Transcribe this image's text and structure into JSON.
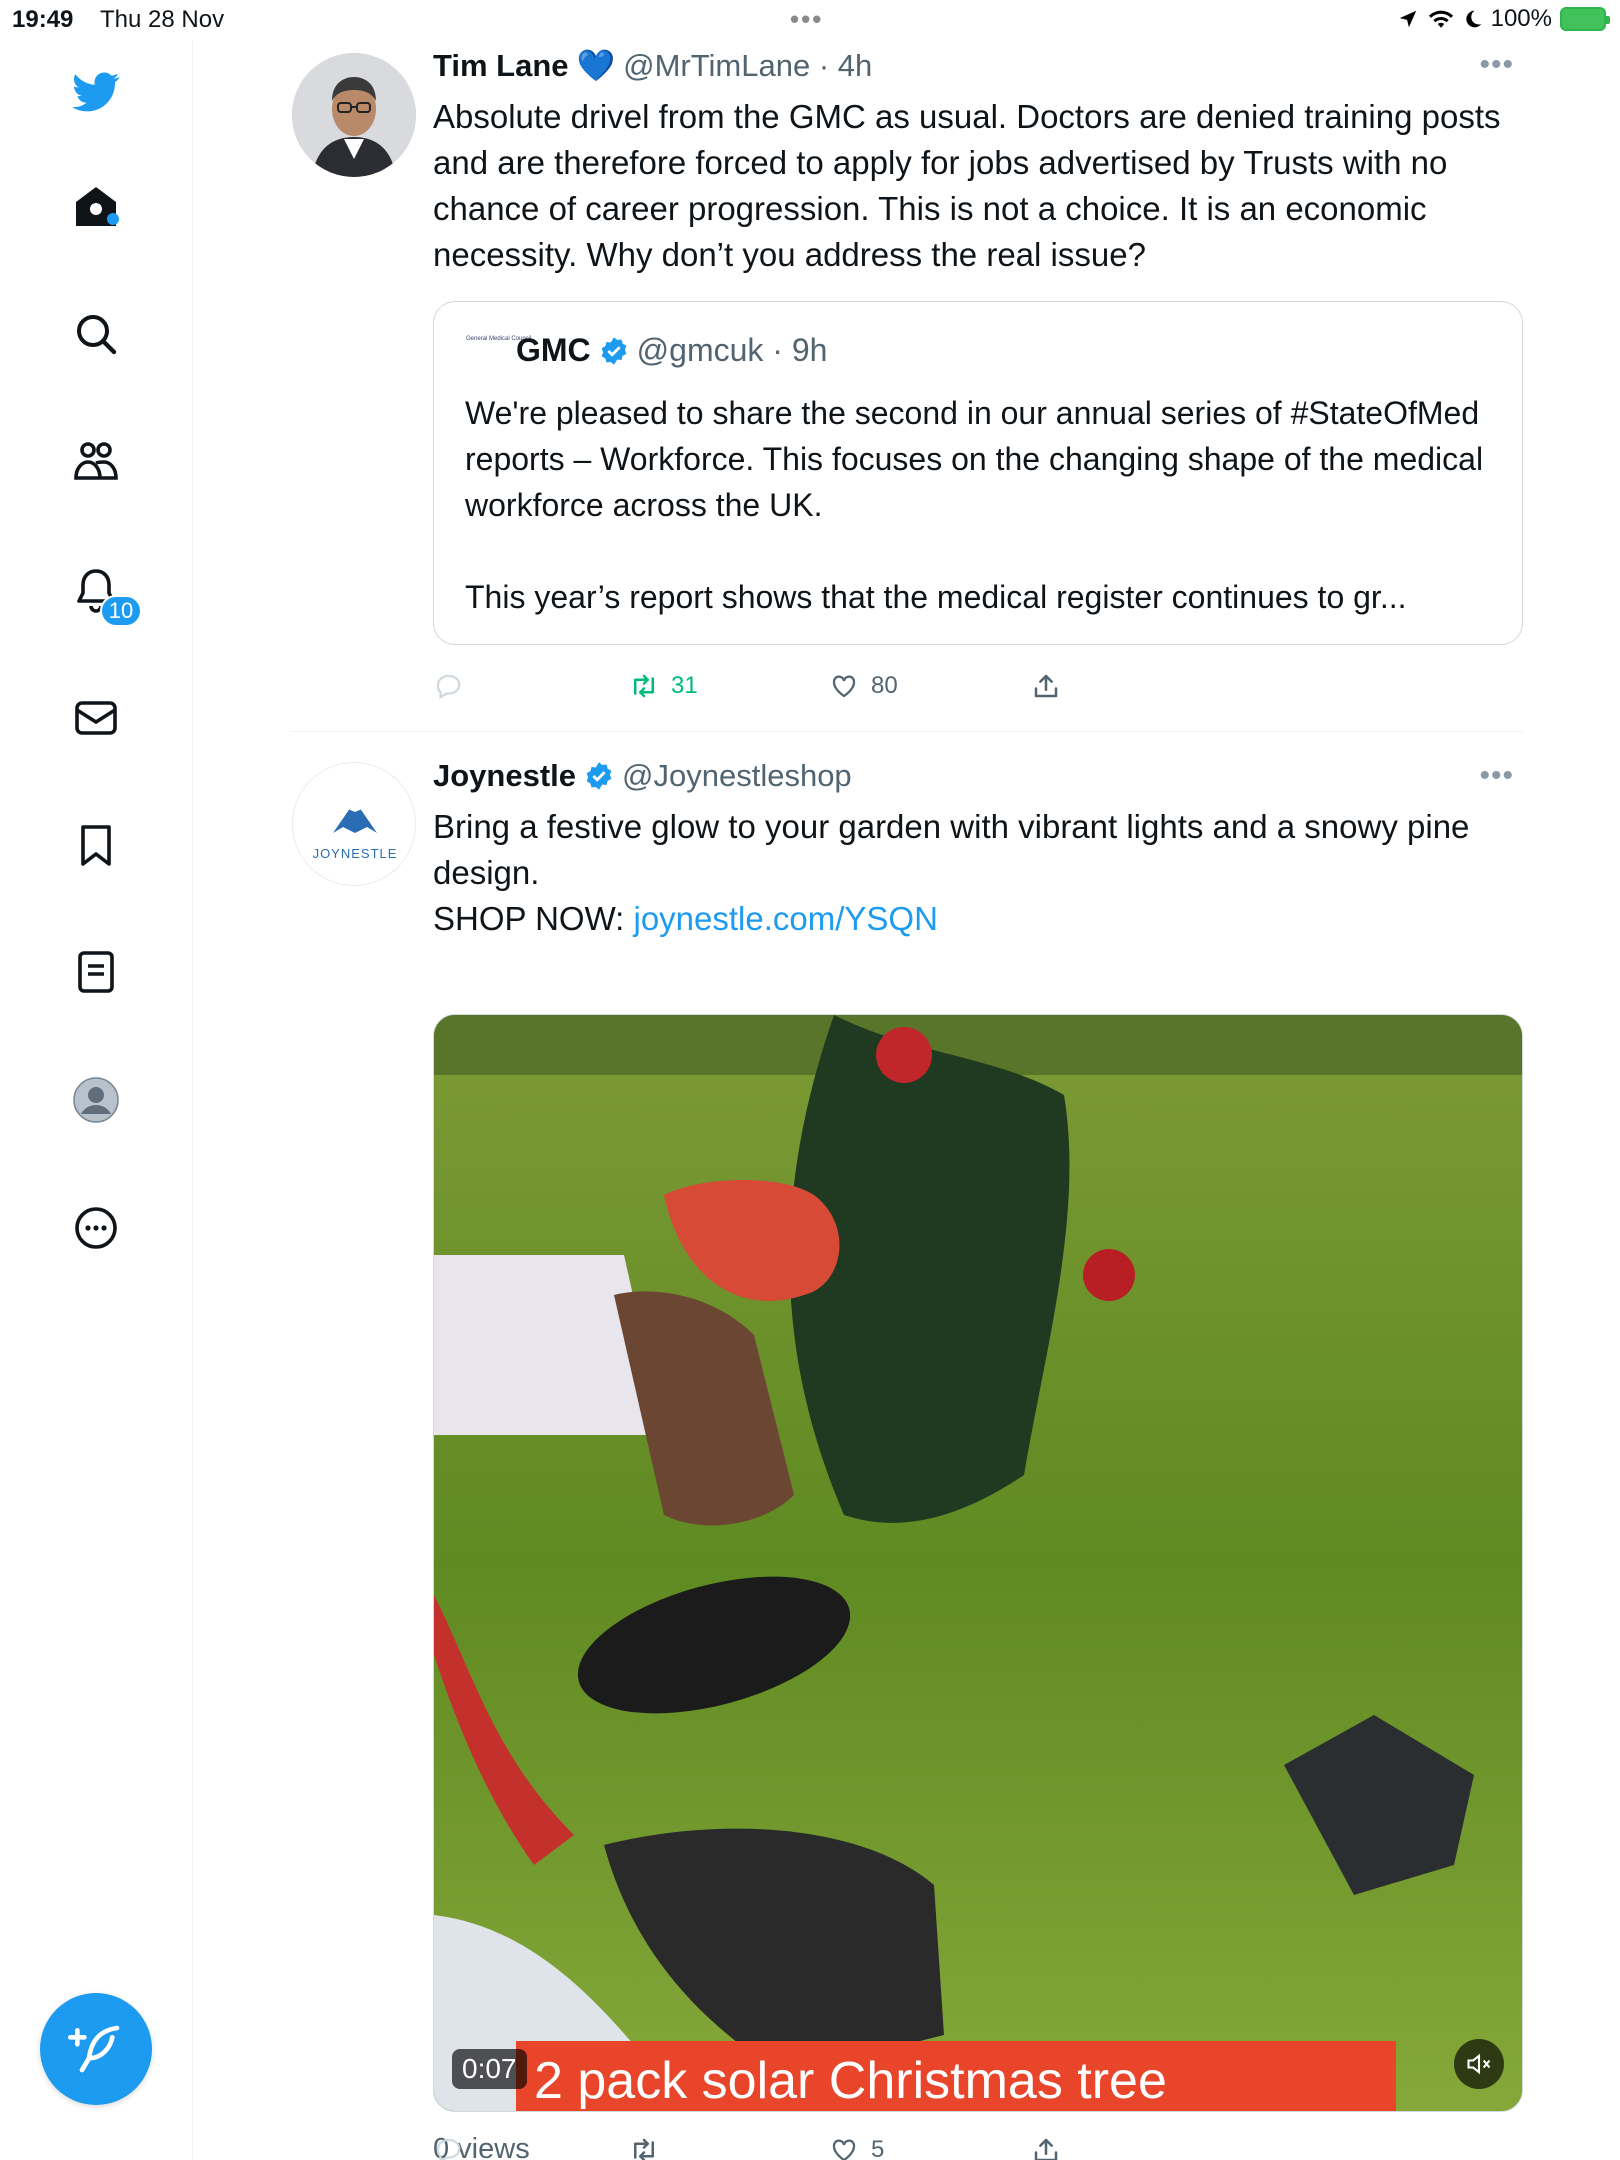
{
  "status_bar": {
    "time": "19:49",
    "date": "Thu 28 Nov",
    "battery": "100%"
  },
  "sidebar": {
    "items": [
      {
        "name": "home"
      },
      {
        "name": "explore"
      },
      {
        "name": "communities"
      },
      {
        "name": "notifications",
        "badge": "10"
      },
      {
        "name": "messages"
      },
      {
        "name": "bookmarks"
      },
      {
        "name": "lists"
      },
      {
        "name": "profile"
      },
      {
        "name": "more"
      }
    ]
  },
  "tweets": [
    {
      "name": "Tim Lane",
      "emoji": "💙",
      "handle": "@MrTimLane",
      "time": "4h",
      "text": "Absolute drivel from the GMC as usual. Doctors are denied training posts and are therefore forced to apply for jobs advertised by Trusts with no chance of career progression. This is not a choice. It is an economic necessity. Why don’t you address the real issue?",
      "quote": {
        "logo_text": "General Medical Council",
        "name": "GMC",
        "handle": "@gmcuk",
        "time": "9h",
        "text": "We're pleased to share the second in our annual series of #StateOfMed reports – Workforce. This focuses on the changing shape of the medical workforce across the UK.\n\nThis year’s report shows that the medical register continues to gr..."
      },
      "stats": {
        "replies": "",
        "retweets": "31",
        "likes": "80"
      }
    },
    {
      "name": "Joynestle",
      "handle": "@Joynestleshop",
      "avatar_text": "JOYNESTLE",
      "text_line": "Bring a festive glow to your garden with vibrant lights and a snowy pine design.",
      "shop_label": "SHOP NOW: ",
      "link": "joynestle.com/YSQN",
      "video": {
        "duration": "0:07",
        "caption": "2 pack solar Christmas tree"
      },
      "views": "0 views",
      "stats": {
        "replies": "",
        "retweets": "",
        "likes": "5"
      }
    }
  ],
  "colors": {
    "accent": "#1d9bf0",
    "retweet_active": "#00ba7c",
    "muted": "#536471"
  }
}
